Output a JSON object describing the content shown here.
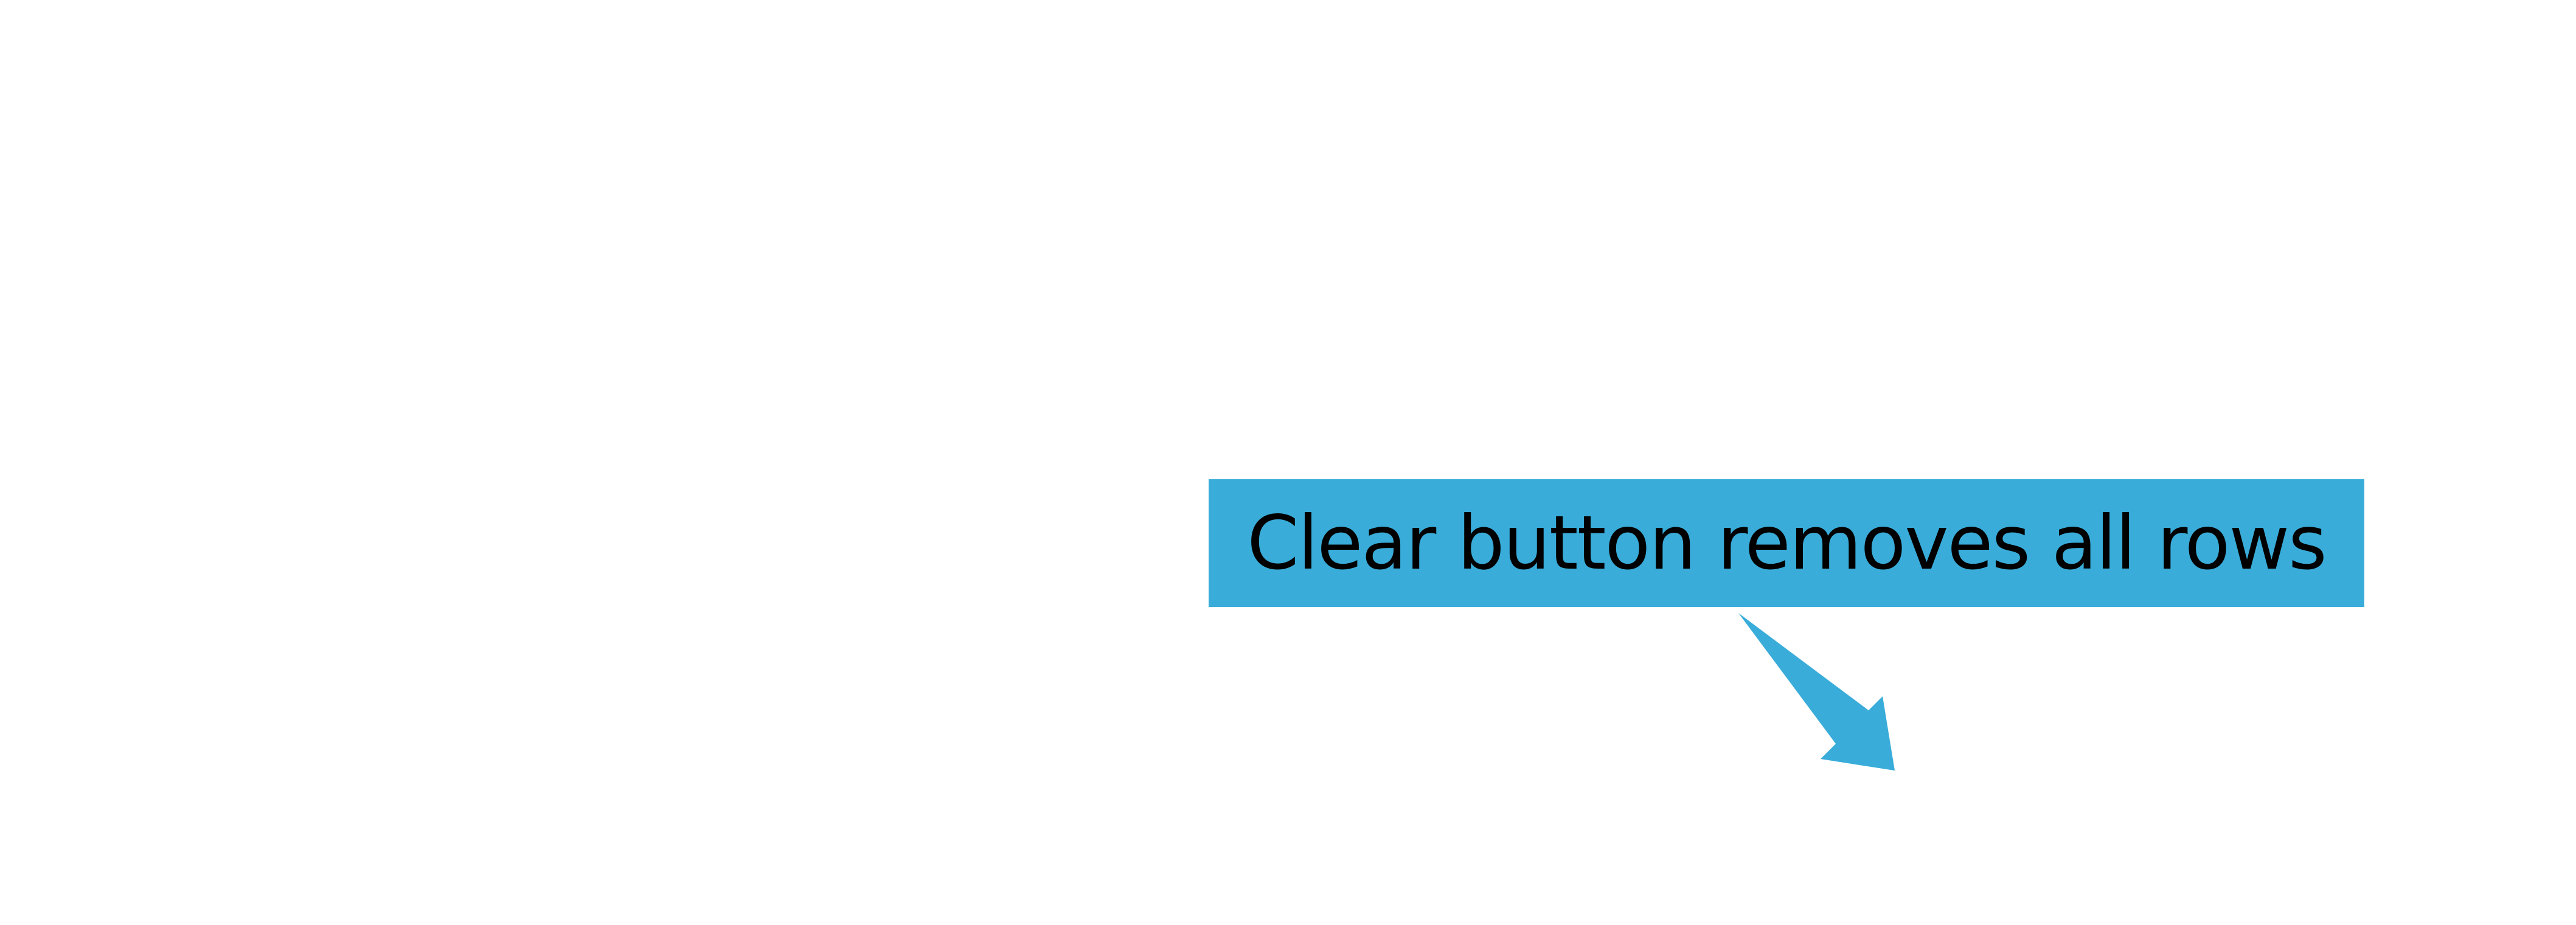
{
  "callout": {
    "text": "Clear button removes all rows",
    "background_color": "#39acd9",
    "text_color": "#000000"
  },
  "arrow": {
    "icon": "diagonal-arrow-down-right-icon",
    "color": "#39acd9"
  }
}
